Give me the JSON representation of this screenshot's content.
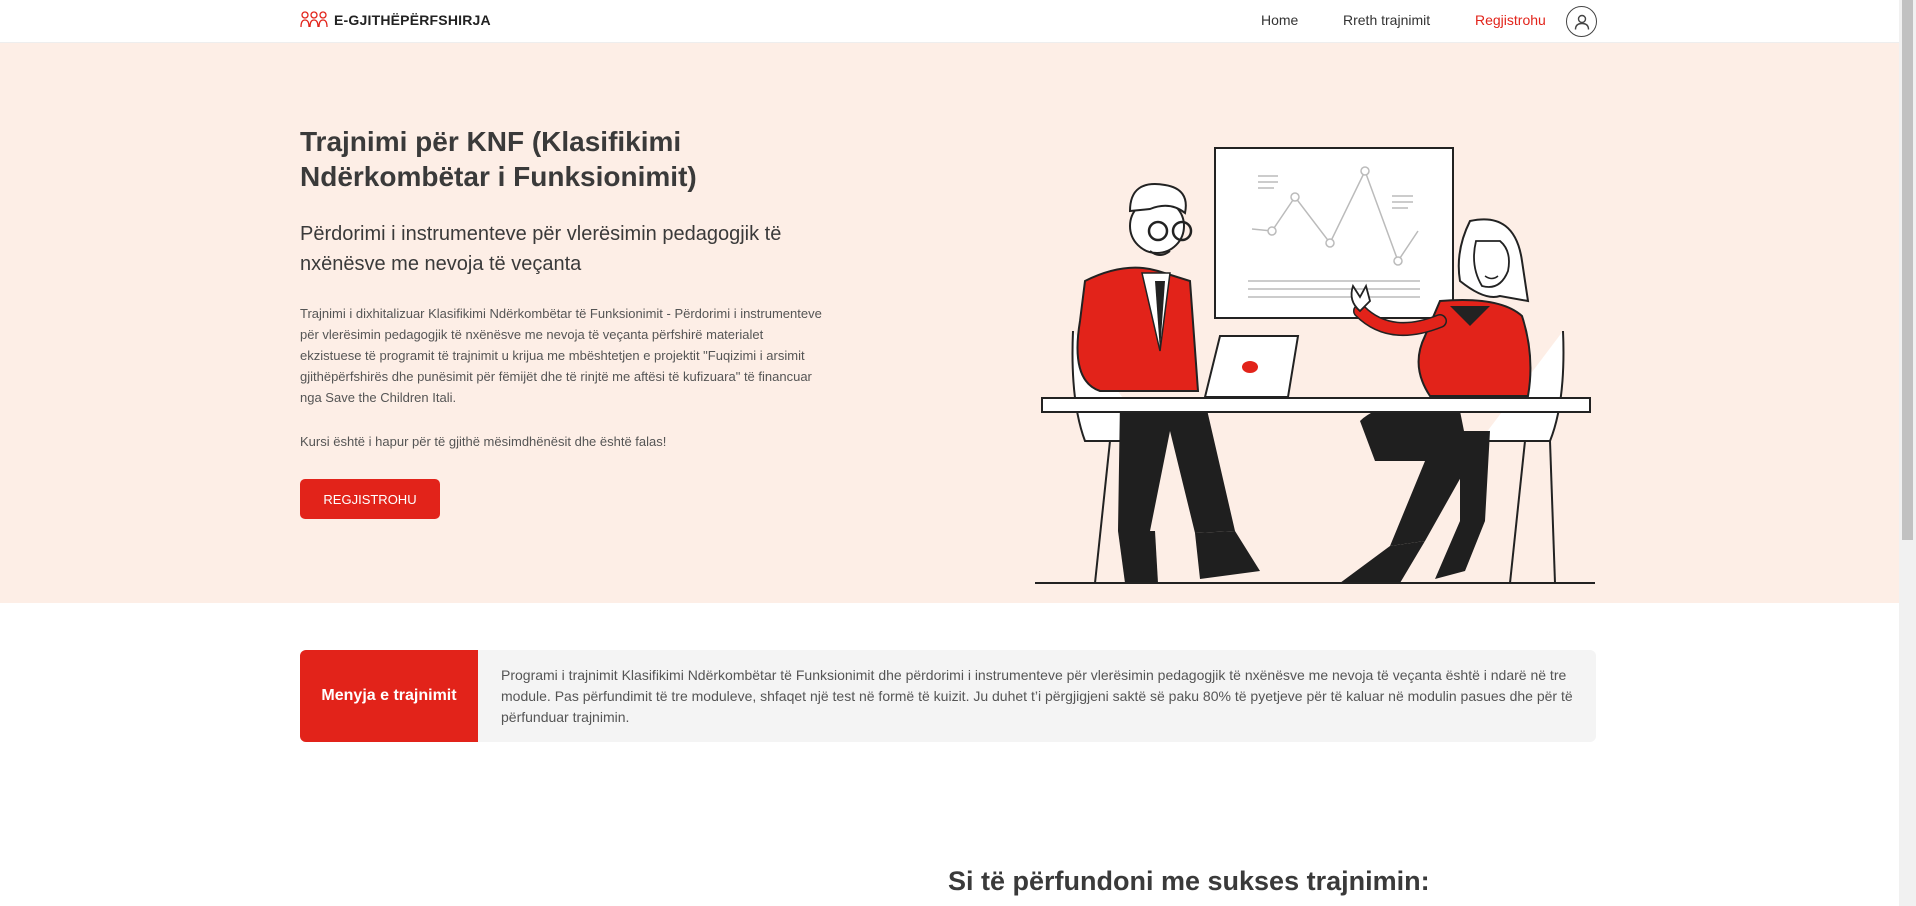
{
  "header": {
    "logo_text": "E-GJITHËPËRFSHIRJA",
    "nav": [
      {
        "label": "Home"
      },
      {
        "label": "Rreth trajnimit"
      },
      {
        "label": "Regjistrohu"
      }
    ]
  },
  "hero": {
    "title": "Trajnimi për KNF (Klasifikimi Ndërkombëtar i Funksionimit)",
    "subtitle": "Përdorimi i instrumenteve për vlerësimin pedagogjik të nxënësve me nevoja të veçanta",
    "body": "Trajnimi i dixhitalizuar Klasifikimi Ndërkombëtar të Funksionimit - Përdorimi i instrumenteve për vlerësimin pedagogjik të nxënësve me nevoja të veçanta përfshirë materialet ekzistuese të programit të trajnimit u krijua me mbështetjen e projektit \"Fuqizimi i arsimit gjithëpërfshirës dhe punësimit për fëmijët dhe të rinjtë me aftësi të kufizuara\" të financuar nga Save the Children Itali.",
    "note": "Kursi është i hapur për të gjithë mësimdhënësit dhe është falas!",
    "cta_label": "REGJISTROHU"
  },
  "menu": {
    "label": "Menyja e trajnimit",
    "text": "Programi i trajnimit Klasifikimi Ndërkombëtar të Funksionimit dhe përdorimi i instrumenteve për vlerësimin pedagogjik të nxënësve me nevoja të veçanta është i ndarë në tre module. Pas përfundimit të tre moduleve, shfaqet një test në formë të kuizit. Ju duhet t’i përgjigjeni saktë së paku 80% të pyetjeve për të kaluar në modulin pasues dhe për të përfunduar trajnimin."
  },
  "section": {
    "title": "Si të përfundoni me sukses trajnimin:"
  },
  "colors": {
    "accent": "#e2231a",
    "hero_bg": "#fdeee6",
    "menu_bg": "#f4f4f4"
  },
  "icons": {
    "logo": "people-group-icon",
    "user": "user-icon"
  }
}
